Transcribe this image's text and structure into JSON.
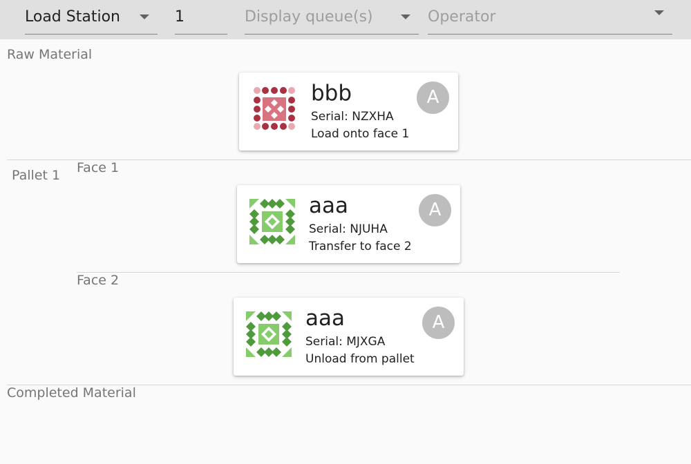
{
  "toolbar": {
    "station_select": {
      "value": "Load Station"
    },
    "station_number": {
      "value": "1"
    },
    "queue_select": {
      "placeholder": "Display queue(s)"
    },
    "operator_select": {
      "placeholder": "Operator"
    }
  },
  "sections": {
    "raw_material": "Raw Material",
    "pallet": "Pallet 1",
    "face1": "Face 1",
    "face2": "Face 2",
    "completed": "Completed Material"
  },
  "cards": [
    {
      "part": "bbb",
      "serial": "Serial: NZXHA",
      "action": "Load onto face 1",
      "avatar": "A",
      "icon": "red-pattern-identicon"
    },
    {
      "part": "aaa",
      "serial": "Serial: NJUHA",
      "action": "Transfer to face 2",
      "avatar": "A",
      "icon": "green-pattern-identicon"
    },
    {
      "part": "aaa",
      "serial": "Serial: MJXGA",
      "action": "Unload from pallet",
      "avatar": "A",
      "icon": "green-pattern-identicon"
    }
  ],
  "colors": {
    "red_dark": "#a83244",
    "red_light": "#e8a9b1",
    "red_center": "#d9737f",
    "green_dark": "#4f9a3c",
    "green_light": "#86cc6d"
  }
}
